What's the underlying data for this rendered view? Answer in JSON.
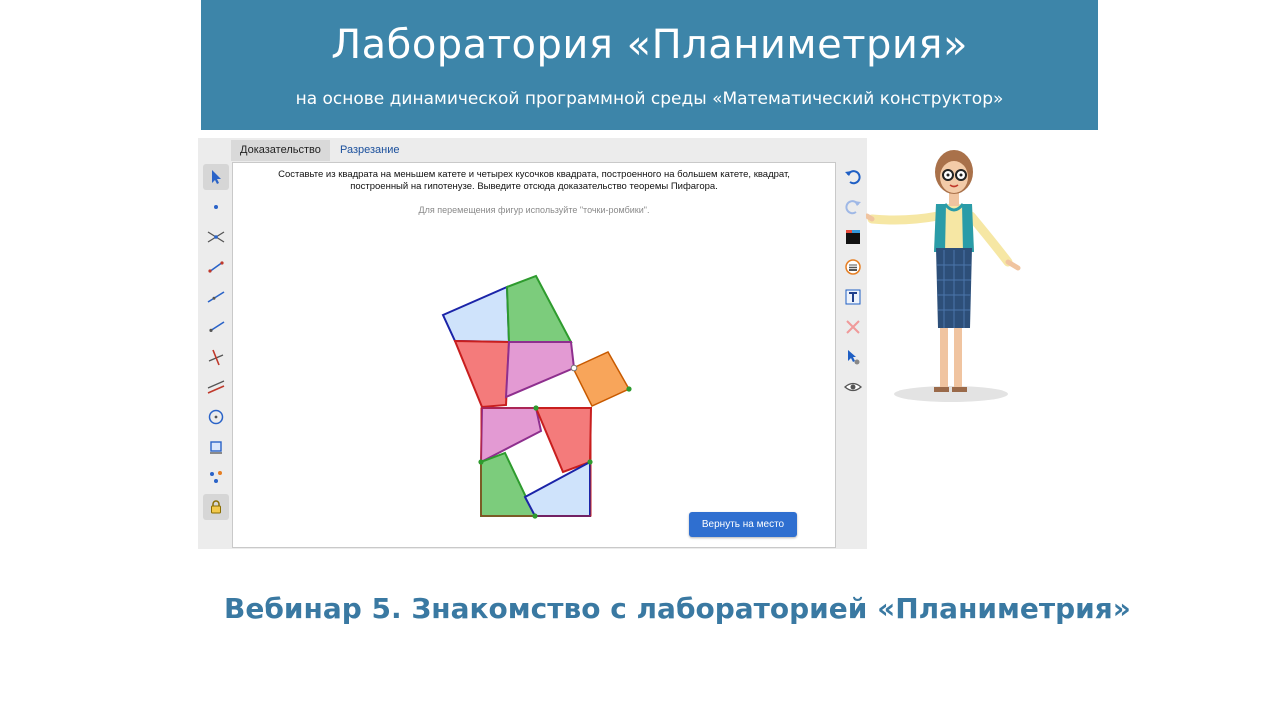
{
  "banner": {
    "title": "Лаборатория «Планиметрия»",
    "subtitle": "на основе динамической программной среды «Математический конструктор»"
  },
  "tabs": [
    {
      "label": "Доказательство",
      "active": true
    },
    {
      "label": "Разрезание",
      "active": false
    }
  ],
  "canvas": {
    "task_text": "Составьте из квадрата на меньшем катете и четырех кусочков квадрата, построенного на большем катете, квадрат, построенный на гипотенузе. Выведите отсюда доказательство теоремы Пифагора.",
    "hint_text": "Для перемещения фигур используйте \"точки-ромбики\".",
    "reset_button": "Вернуть на место"
  },
  "left_tools": [
    "pointer-icon",
    "point-icon",
    "intersection-icon",
    "segment-icon",
    "line-icon",
    "ray-icon",
    "perpendicular-icon",
    "parallel-icon",
    "circle-icon",
    "polygon-icon",
    "transform-icon",
    "lock-icon"
  ],
  "right_tools": [
    "undo-icon",
    "redo-icon",
    "color-icon",
    "style-icon",
    "text-icon",
    "delete-icon",
    "show-hide-icon",
    "eye-icon"
  ],
  "footer": {
    "title": "Вебинар 5. Знакомство с лабораторией «Планиметрия»"
  },
  "colors": {
    "banner": "#3d85a9",
    "piece_blue": "#cfe3fb",
    "piece_green": "#7ccc7c",
    "piece_red": "#f47b7b",
    "piece_pink": "#e39ad3",
    "piece_orange": "#f8a55a",
    "button": "#2f6fd0"
  }
}
